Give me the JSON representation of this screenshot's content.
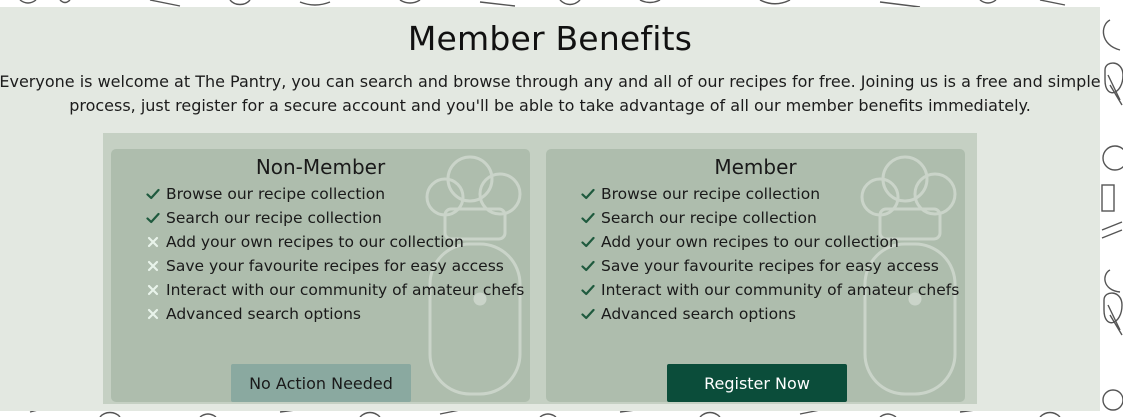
{
  "section": {
    "title": "Member Benefits",
    "intro": "Everyone is welcome at The Pantry, you can search and browse through any and all of our recipes for free. Joining us is a free and simple process, just register for a secure account and you'll be able to take advantage of all our member benefits immediately."
  },
  "non_member": {
    "title": "Non-Member",
    "features": [
      {
        "text": "Browse our recipe collection",
        "included": true
      },
      {
        "text": "Search our recipe collection",
        "included": true
      },
      {
        "text": "Add your own recipes to our collection",
        "included": false
      },
      {
        "text": "Save your favourite recipes for easy access",
        "included": false
      },
      {
        "text": "Interact with our community of amateur chefs",
        "included": false
      },
      {
        "text": "Advanced search options",
        "included": false
      }
    ],
    "button_label": "No Action Needed"
  },
  "member": {
    "title": "Member",
    "features": [
      {
        "text": "Browse our recipe collection",
        "included": true
      },
      {
        "text": "Search our recipe collection",
        "included": true
      },
      {
        "text": "Add your own recipes to our collection",
        "included": true
      },
      {
        "text": "Save your favourite recipes for easy access",
        "included": true
      },
      {
        "text": "Interact with our community of amateur chefs",
        "included": true
      },
      {
        "text": "Advanced search options",
        "included": true
      }
    ],
    "button_label": "Register Now"
  },
  "icons": {
    "included": "check-icon",
    "excluded": "cross-icon"
  },
  "colors": {
    "check": "#1f5a3e",
    "cross": "#e8f3ea",
    "register_button": "#0b4d3a",
    "noaction_button": "#8aa9a0",
    "section_bg": "#e3e8e1"
  }
}
